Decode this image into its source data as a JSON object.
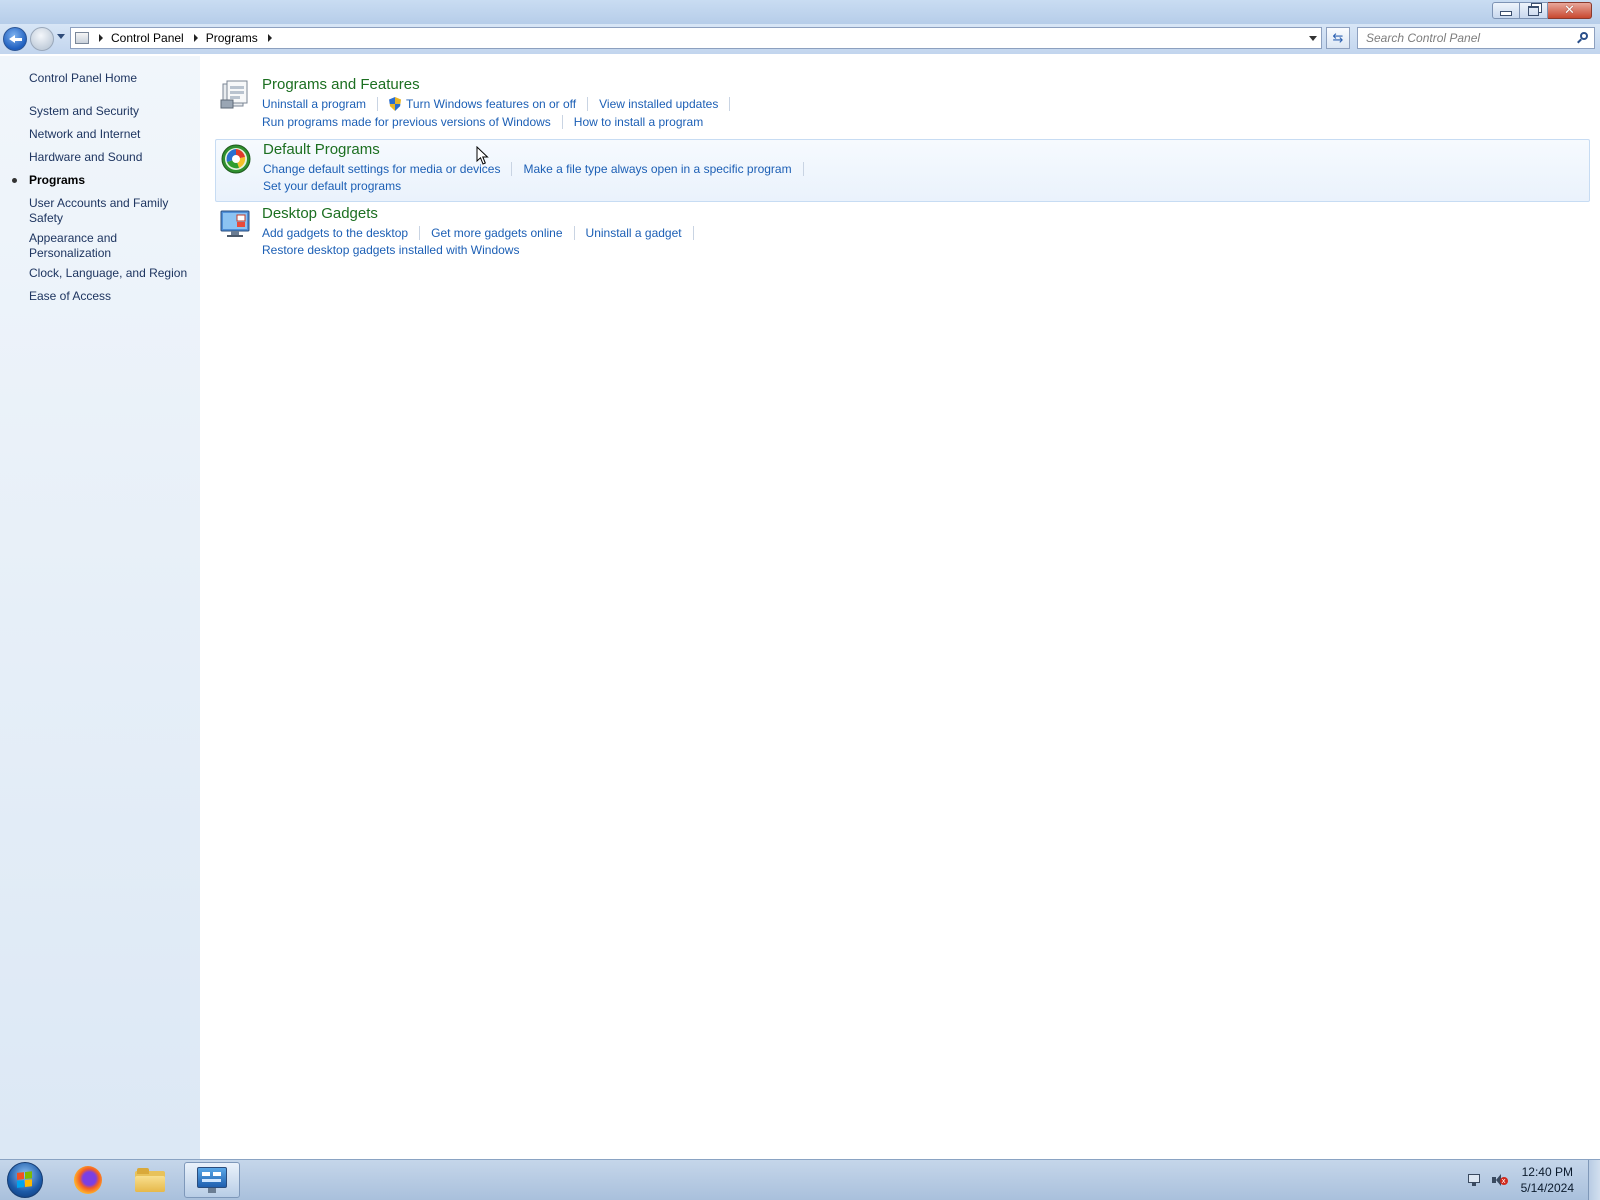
{
  "window": {
    "controls": {
      "minimize": "",
      "maximize": "",
      "close": "✕"
    }
  },
  "address": {
    "crumbs": [
      "Control Panel",
      "Programs"
    ],
    "search_placeholder": "Search Control Panel"
  },
  "sidebar": {
    "home": "Control Panel Home",
    "items": [
      {
        "label": "System and Security",
        "active": false
      },
      {
        "label": "Network and Internet",
        "active": false
      },
      {
        "label": "Hardware and Sound",
        "active": false
      },
      {
        "label": "Programs",
        "active": true
      },
      {
        "label": "User Accounts and Family Safety",
        "active": false
      },
      {
        "label": "Appearance and Personalization",
        "active": false
      },
      {
        "label": "Clock, Language, and Region",
        "active": false
      },
      {
        "label": "Ease of Access",
        "active": false
      }
    ]
  },
  "categories": [
    {
      "title": "Programs and Features",
      "icon": "programs-features-icon",
      "row1": [
        "Uninstall a program",
        "Turn Windows features on or off",
        "View installed updates"
      ],
      "row2": [
        "Run programs made for previous versions of Windows",
        "How to install a program"
      ]
    },
    {
      "title": "Default Programs",
      "icon": "default-programs-icon",
      "row1": [
        "Change default settings for media or devices",
        "Make a file type always open in a specific program"
      ],
      "row2": [
        "Set your default programs"
      ]
    },
    {
      "title": "Desktop Gadgets",
      "icon": "desktop-gadgets-icon",
      "row1": [
        "Add gadgets to the desktop",
        "Get more gadgets online",
        "Uninstall a gadget"
      ],
      "row2": [
        "Restore desktop gadgets installed with Windows"
      ]
    }
  ],
  "taskbar": {
    "apps": [
      "start-orb",
      "firefox-icon",
      "file-explorer-icon",
      "control-panel-icon"
    ],
    "time": "12:40 PM",
    "date": "5/14/2024"
  },
  "colors": {
    "category_title": "#1c6f21",
    "link": "#1c5fb5",
    "sidebar_link": "#1e3560"
  }
}
